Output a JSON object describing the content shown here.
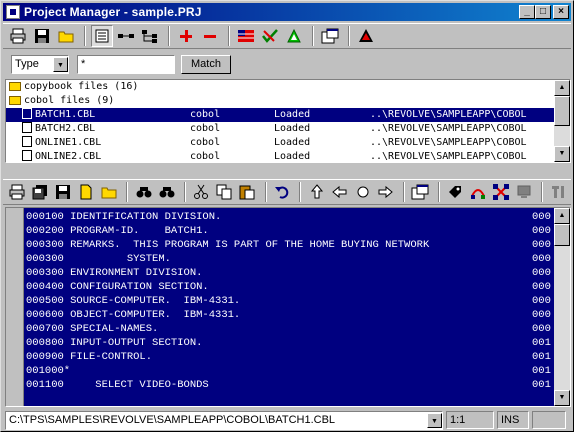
{
  "window": {
    "title": "Project Manager - sample.PRJ",
    "buttons": {
      "minimize": "_",
      "maximize": "□",
      "close": "×"
    }
  },
  "toolbar_top": {
    "icons": [
      "print-icon",
      "save-icon",
      "open-folder-icon",
      "project-view-icon",
      "link-icon",
      "tree-icon",
      "add-icon",
      "remove-icon",
      "flag-icon",
      "checklist-icon",
      "triangle-icon",
      "properties-icon",
      "warning-icon"
    ]
  },
  "filter": {
    "type_selected": "Type",
    "pattern_value": "*",
    "match_label": "Match"
  },
  "filelist": {
    "folders": [
      {
        "label": "copybook files (16)"
      },
      {
        "label": "cobol files (9)"
      }
    ],
    "files": [
      {
        "name": "BATCH1.CBL",
        "type": "cobol",
        "status": "Loaded",
        "path": "..\\REVOLVE\\SAMPLEAPP\\COBOL",
        "selected": true
      },
      {
        "name": "BATCH2.CBL",
        "type": "cobol",
        "status": "Loaded",
        "path": "..\\REVOLVE\\SAMPLEAPP\\COBOL",
        "selected": false
      },
      {
        "name": "ONLINE1.CBL",
        "type": "cobol",
        "status": "Loaded",
        "path": "..\\REVOLVE\\SAMPLEAPP\\COBOL",
        "selected": false
      },
      {
        "name": "ONLINE2.CBL",
        "type": "cobol",
        "status": "Loaded",
        "path": "..\\REVOLVE\\SAMPLEAPP\\COBOL",
        "selected": false
      }
    ]
  },
  "editor": {
    "lines": [
      {
        "text": "000100 IDENTIFICATION DIVISION.",
        "right": "000"
      },
      {
        "text": "000200 PROGRAM-ID.    BATCH1.",
        "right": "000"
      },
      {
        "text": "000300 REMARKS.  THIS PROGRAM IS PART OF THE HOME BUYING NETWORK",
        "right": "000"
      },
      {
        "text": "000300          SYSTEM.",
        "right": "000"
      },
      {
        "text": "000300 ENVIRONMENT DIVISION.",
        "right": "000"
      },
      {
        "text": "000400 CONFIGURATION SECTION.",
        "right": "000"
      },
      {
        "text": "000500 SOURCE-COMPUTER.  IBM-4331.",
        "right": "000"
      },
      {
        "text": "000600 OBJECT-COMPUTER.  IBM-4331.",
        "right": "000"
      },
      {
        "text": "000700 SPECIAL-NAMES.",
        "right": "000"
      },
      {
        "text": "000800 INPUT-OUTPUT SECTION.",
        "right": "001"
      },
      {
        "text": "000900 FILE-CONTROL.",
        "right": "001"
      },
      {
        "text": "001000*",
        "right": "001"
      },
      {
        "text": "001100     SELECT VIDEO-BONDS",
        "right": "001"
      }
    ]
  },
  "status": {
    "path": "C:\\TPS\\SAMPLES\\REVOLVE\\SAMPLEAPP\\COBOL\\BATCH1.CBL",
    "position": "1:1",
    "mode": "INS"
  }
}
